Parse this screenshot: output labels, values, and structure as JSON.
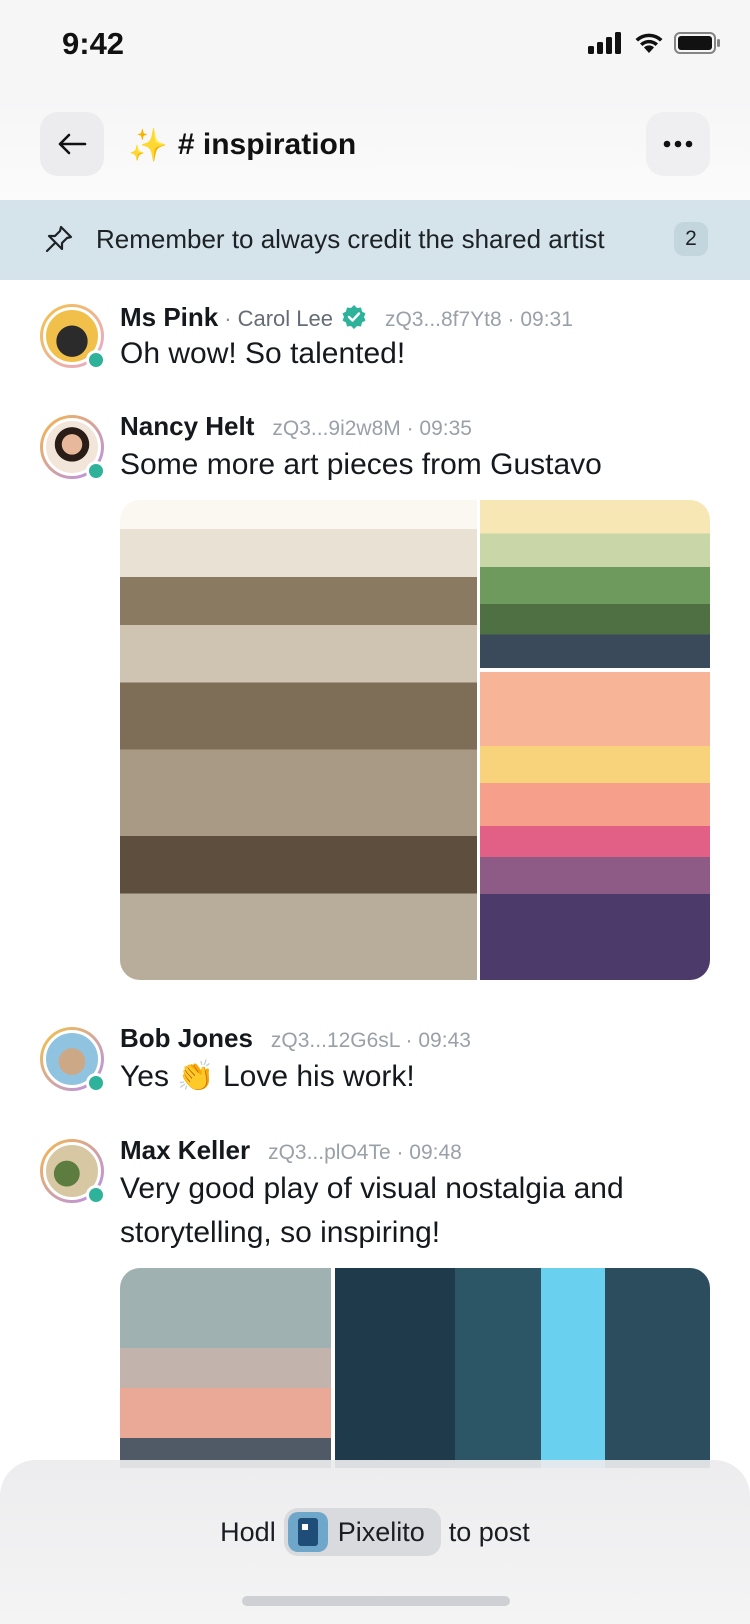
{
  "status": {
    "time": "9:42"
  },
  "header": {
    "emoji": "✨",
    "title": "# inspiration"
  },
  "pinned": {
    "text": "Remember to always credit the shared artist",
    "count": "2"
  },
  "messages": [
    {
      "name": "Ms Pink",
      "display": "Carol Lee",
      "verified": true,
      "handle": "zQ3...8f7Yt8 · 09:31",
      "text": "Oh wow! So talented!"
    },
    {
      "name": "Nancy Helt",
      "handle": "zQ3...9i2w8M · 09:35",
      "text": "Some more art pieces from Gustavo"
    },
    {
      "name": "Bob Jones",
      "handle": "zQ3...12G6sL · 09:43",
      "text": "Yes 👏 Love his work!"
    },
    {
      "name": "Max Keller",
      "handle": "zQ3...plO4Te · 09:48",
      "text_line1": "Very good play of visual nostalgia and",
      "text_line2": "storytelling, so inspiring!"
    }
  ],
  "composer": {
    "prefix": "Hodl",
    "token": "Pixelito",
    "suffix": "to post"
  },
  "colors": {
    "presence": "#2eb39a",
    "pin_bar": "#d4e4ea",
    "verified": "#2eb39a"
  }
}
